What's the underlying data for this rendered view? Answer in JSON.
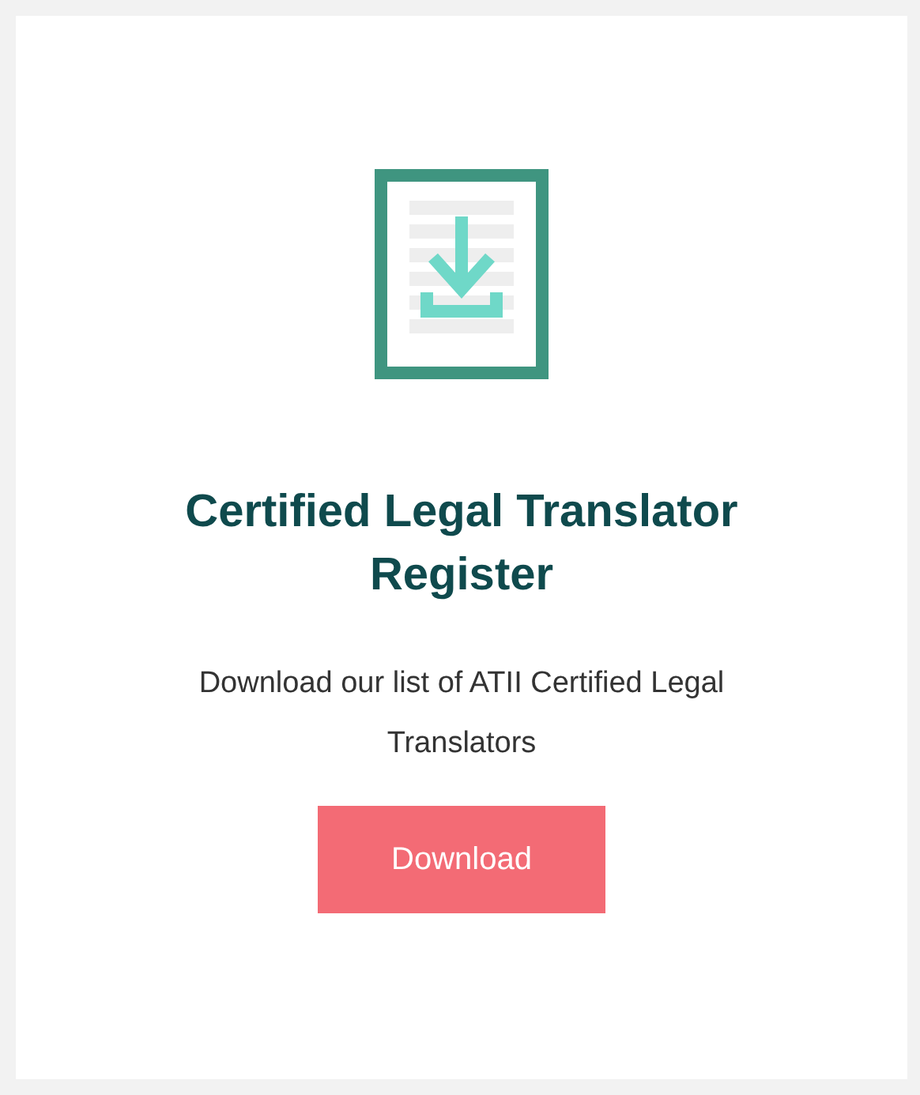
{
  "card": {
    "title": "Certified Legal Translator Register",
    "description": "Download our list of ATII Certified Legal Translators",
    "button": "Download"
  }
}
